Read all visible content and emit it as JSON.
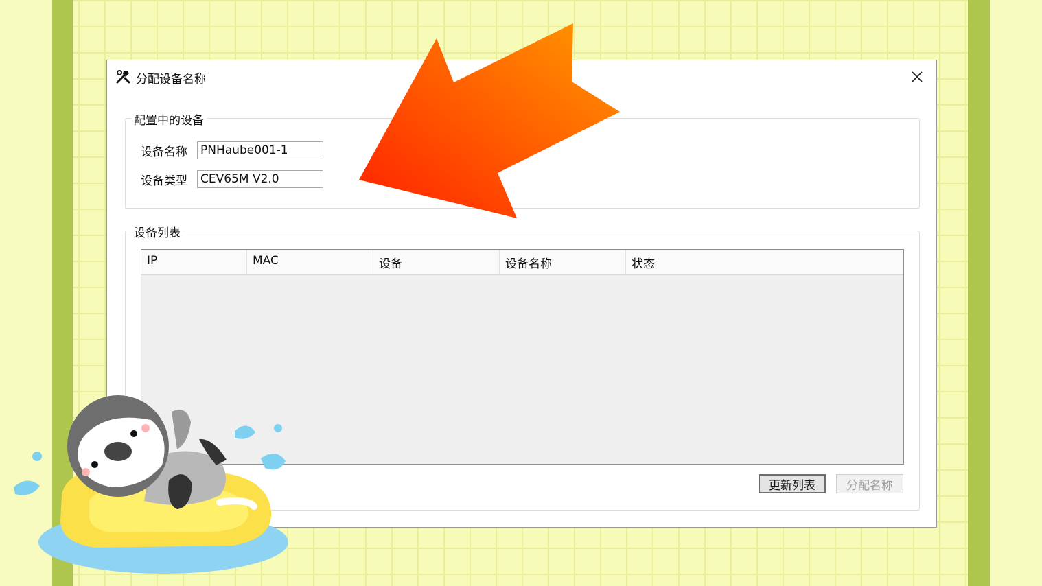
{
  "window": {
    "title": "分配设备名称",
    "title_icon": "tools-icon",
    "close_icon": "close-icon"
  },
  "configuring_group": {
    "legend": "配置中的设备",
    "device_name_label": "设备名称",
    "device_name_value": "PNHaube001-1",
    "device_type_label": "设备类型",
    "device_type_value": "CEV65M V2.0"
  },
  "device_list_group": {
    "legend": "设备列表",
    "columns": [
      "IP",
      "MAC",
      "设备",
      "设备名称",
      "状态"
    ],
    "rows": []
  },
  "buttons": {
    "refresh_label": "更新列表",
    "assign_label": "分配名称"
  },
  "colors": {
    "arrow_start": "#ff1f00",
    "arrow_end": "#ff9a00",
    "stripe": "#aec54e",
    "background": "#f7fbb8"
  }
}
